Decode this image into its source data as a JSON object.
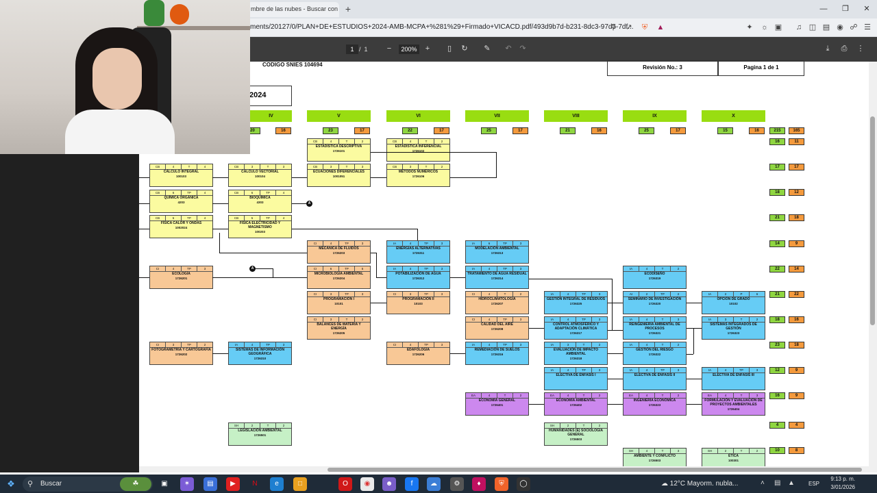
{
  "browser": {
    "tab_title": "mbre de las nubes - Buscar con G",
    "new_tab": "+",
    "url": "ments/20127/0/PLAN+DE+ESTUDIOS+2024-AMB-MCPA+%281%29+Firmado+VICACD.pdf/493d9b7d-b231-8dc3-97d5-7df..."
  },
  "pdf": {
    "page_current": "1",
    "page_sep": "/",
    "page_total": "1",
    "zoom": "200%"
  },
  "doc": {
    "snies": "CODIGO SNIES 104694",
    "revision": "Revisión No.: 3",
    "pagina": "Pagina 1 de 1",
    "year": "2024"
  },
  "semesters": [
    {
      "label": "IV",
      "g": "20",
      "o": "16"
    },
    {
      "label": "V",
      "g": "23",
      "o": "17"
    },
    {
      "label": "VI",
      "g": "22",
      "o": "17"
    },
    {
      "label": "VII",
      "g": "25",
      "o": "17"
    },
    {
      "label": "VIII",
      "g": "21",
      "o": "16"
    },
    {
      "label": "IX",
      "g": "25",
      "o": "17"
    },
    {
      "label": "X",
      "g": "15",
      "o": "16"
    }
  ],
  "totals": [
    {
      "g": "215",
      "o": "165"
    },
    {
      "g": "16",
      "o": "11"
    },
    {
      "g": "17",
      "o": "17"
    },
    {
      "g": "18",
      "o": "12"
    },
    {
      "g": "21",
      "o": "18"
    },
    {
      "g": "14",
      "o": "9"
    },
    {
      "g": "22",
      "o": "14"
    },
    {
      "g": "21",
      "o": "22"
    },
    {
      "g": "18",
      "o": "16"
    },
    {
      "g": "23",
      "o": "18"
    },
    {
      "g": "12",
      "o": "9"
    },
    {
      "g": "16",
      "o": "9"
    },
    {
      "g": "4",
      "o": "4"
    },
    {
      "g": "10",
      "o": "8"
    }
  ],
  "courses": [
    {
      "h": [
        "CB",
        "4",
        "T",
        "2"
      ],
      "name": "ESTADÍSTICA DESCRIPTIVA",
      "code": "1726101",
      "c": "y"
    },
    {
      "h": [
        "CB",
        "4",
        "T",
        "2"
      ],
      "name": "ESTADÍSTICA INFERENCIAL",
      "code": "1726102",
      "c": "y"
    },
    {
      "h": [
        "CB",
        "4",
        "T",
        "4"
      ],
      "name": "CÁLCULO INTEGRAL",
      "code": "100103",
      "c": "y"
    },
    {
      "h": [
        "CB",
        "3",
        "T",
        "3"
      ],
      "name": "CÁLCULO VECTORIAL",
      "code": "100104",
      "c": "y"
    },
    {
      "h": [
        "CB",
        "3",
        "T",
        "3"
      ],
      "name": "ECUACIONES DIFERENCIALES",
      "code": "1001051",
      "c": "y"
    },
    {
      "h": [
        "CB",
        "3",
        "T",
        "2"
      ],
      "name": "MÉTODOS NUMÉRICOS",
      "code": "1726106",
      "c": "y"
    },
    {
      "h": [
        "CB",
        "6",
        "TP",
        "4"
      ],
      "name": "QUÍMICA ORGÁNICA",
      "code": "4203",
      "c": "y"
    },
    {
      "h": [
        "CB",
        "6",
        "TP",
        "4"
      ],
      "name": "BIOQUÍMICA",
      "code": "4303",
      "c": "y"
    },
    {
      "h": [
        "CB",
        "5",
        "TP",
        "4"
      ],
      "name": "FÍSICA CALOR Y ONDAS",
      "code": "1002024",
      "c": "y"
    },
    {
      "h": [
        "CB",
        "5",
        "TP",
        "4"
      ],
      "name": "FÍSICA ELECTRICIDAD Y MAGNETISMO",
      "code": "100203",
      "c": "y"
    },
    {
      "h": [
        "CI",
        "4",
        "TP",
        "3"
      ],
      "name": "MECÁNICA DE FLUIDOS",
      "code": "1726203",
      "c": "oc"
    },
    {
      "h": [
        "IA",
        "4",
        "TP",
        "3"
      ],
      "name": "ENERGÍAS ALTERNATIVAS",
      "code": "1726311",
      "c": "b"
    },
    {
      "h": [
        "IA",
        "6",
        "TP",
        "3"
      ],
      "name": "MODELACIÓN AMBIENTAL",
      "code": "1726313",
      "c": "b"
    },
    {
      "h": [
        "CI",
        "4",
        "TP",
        "3"
      ],
      "name": "ECOLOGÍA",
      "code": "1726201",
      "c": "oc"
    },
    {
      "h": [
        "CI",
        "6",
        "TP",
        "5"
      ],
      "name": "MICROBIOLOGÍA AMBIENTAL",
      "code": "1726204",
      "c": "oc"
    },
    {
      "h": [
        "IA",
        "4",
        "TP",
        "3"
      ],
      "name": "POTABILIZACIÓN DE AGUA",
      "code": "1726312",
      "c": "b"
    },
    {
      "h": [
        "IA",
        "4",
        "TP",
        "3"
      ],
      "name": "TRATAMIENTO DE AGUA RESIDUAL",
      "code": "1726314",
      "c": "b"
    },
    {
      "h": [
        "IA",
        "4",
        "T",
        "2"
      ],
      "name": "ECODISEÑO",
      "code": "1726319",
      "c": "b"
    },
    {
      "h": [
        "CI",
        "3",
        "TP",
        "3"
      ],
      "name": "PROGRAMACIÓN I",
      "code": "10101",
      "c": "oc"
    },
    {
      "h": [
        "CI",
        "3",
        "TP",
        "3"
      ],
      "name": "PROGRAMACIÓN II",
      "code": "10103",
      "c": "oc"
    },
    {
      "h": [
        "CI",
        "4",
        "T",
        "2"
      ],
      "name": "HIDROCLIMATOLOGÍA",
      "code": "1726207",
      "c": "oc"
    },
    {
      "h": [
        "IA",
        "4",
        "TP",
        "3"
      ],
      "name": "GESTIÓN INTEGRAL DE RESIDUOS",
      "code": "1726325",
      "c": "b"
    },
    {
      "h": [
        "AI",
        "2",
        "TP",
        "2"
      ],
      "name": "SEMINARIO DE INVESTIGACIÓN",
      "code": "1726320",
      "c": "b"
    },
    {
      "h": [
        "IA",
        "2",
        "P",
        "6"
      ],
      "name": "OPCIÓN DE GRADO",
      "code": "10102",
      "c": "b"
    },
    {
      "h": [
        "CI",
        "3",
        "T",
        "2"
      ],
      "name": "BALANCES DE MATERIA Y ENERGÍA",
      "code": "1726205",
      "c": "oc"
    },
    {
      "h": [
        "CI",
        "4",
        "TP",
        "3"
      ],
      "name": "CALIDAD DEL AIRE",
      "code": "1726208",
      "c": "oc"
    },
    {
      "h": [
        "IA",
        "4",
        "TP",
        "3"
      ],
      "name": "CONTROL ATMOSFÉRICO Y ADAPTACIÓN CLIMÁTICA",
      "code": "1726317",
      "c": "b"
    },
    {
      "h": [
        "IA",
        "4",
        "T",
        "3"
      ],
      "name": "REINGENIERÍA AMBIENTAL DE PROCESOS",
      "code": "1726321",
      "c": "b"
    },
    {
      "h": [
        "IA",
        "3",
        "T",
        "2"
      ],
      "name": "SISTEMAS INTEGRADOS DE GESTIÓN",
      "code": "1726323",
      "c": "b"
    },
    {
      "h": [
        "CI",
        "3",
        "TP",
        "2"
      ],
      "name": "FOTOGRAMETRÍA Y CARTOGRAFÍA",
      "code": "1726202",
      "c": "oc"
    },
    {
      "h": [
        "IA",
        "4",
        "TP",
        "3"
      ],
      "name": "SISTEMAS DE INFORMACIÓN GEOGRÁFICA",
      "code": "1726310",
      "c": "b"
    },
    {
      "h": [
        "CI",
        "4",
        "TP",
        "3"
      ],
      "name": "EDAFOLOGÍA",
      "code": "1726206",
      "c": "oc"
    },
    {
      "h": [
        "IA",
        "4",
        "TP",
        "3"
      ],
      "name": "REMEDIACIÓN DE SUELOS",
      "code": "1726316",
      "c": "b"
    },
    {
      "h": [
        "IA",
        "3",
        "T",
        "2"
      ],
      "name": "EVALUACIÓN DE IMPACTO AMBIENTAL",
      "code": "1726318",
      "c": "b"
    },
    {
      "h": [
        "IA",
        "4",
        "T",
        "2"
      ],
      "name": "GESTIÓN DEL RIESGO",
      "code": "1726322",
      "c": "b"
    },
    {
      "h": [
        "IA",
        "4",
        "TP",
        "3"
      ],
      "name": "ELECTIVA DE ÉNFASIS I",
      "code": "",
      "c": "b"
    },
    {
      "h": [
        "IA",
        "4",
        "TP",
        "3"
      ],
      "name": "ELECTIVA DE ÉNFASIS II",
      "code": "",
      "c": "b"
    },
    {
      "h": [
        "IA",
        "4",
        "TP",
        "3"
      ],
      "name": "ELECTIVA DE ÉNFASIS III",
      "code": "",
      "c": "b"
    },
    {
      "h": [
        "EA",
        "4",
        "T",
        "2"
      ],
      "name": "ECONOMÍA GENERAL",
      "code": "1726401",
      "c": "p"
    },
    {
      "h": [
        "EA",
        "4",
        "T",
        "2"
      ],
      "name": "ECONOMÍA AMBIENTAL",
      "code": "1726402",
      "c": "p"
    },
    {
      "h": [
        "EA",
        "4",
        "T",
        "2"
      ],
      "name": "INGENIERÍA ECONÓMICA",
      "code": "1726323",
      "c": "p"
    },
    {
      "h": [
        "EA",
        "4",
        "T",
        "3"
      ],
      "name": "FORMULACIÓN Y EVALUACIÓN DE PROYECTOS AMBIENTALES",
      "code": "1726404",
      "c": "p"
    },
    {
      "h": [
        "SH",
        "2",
        "T",
        "2"
      ],
      "name": "LEGISLACIÓN AMBIENTAL",
      "code": "1726501",
      "c": "gl"
    },
    {
      "h": [
        "SH",
        "2",
        "T",
        "2"
      ],
      "name": "HUMANIDADES (E) SOCIOLOGÍA GENERAL",
      "code": "1726503",
      "c": "gl"
    },
    {
      "h": [
        "SH",
        "4",
        "T",
        "3"
      ],
      "name": "AMBIENTE Y CONFLICTO",
      "code": "1726503",
      "c": "gl"
    },
    {
      "h": [
        "SH",
        "2",
        "T",
        "2"
      ],
      "name": "ÉTICA",
      "code": "100301",
      "c": "gl"
    }
  ],
  "connectors": {
    "a1": "A",
    "a2": "A"
  },
  "taskbar": {
    "search": "Buscar",
    "weather": "12°C  Mayorm. nubla...",
    "lang": "ESP",
    "time": "9:13 p. m.",
    "date": "3/01/2026"
  }
}
